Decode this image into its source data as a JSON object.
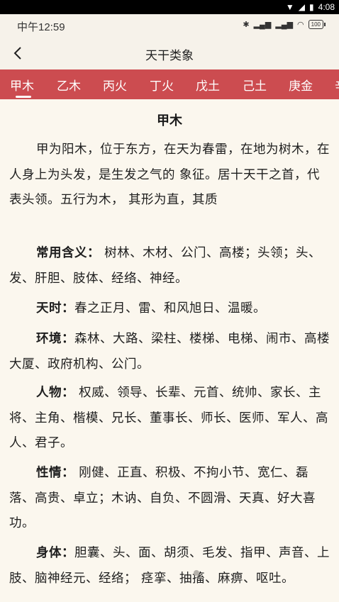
{
  "system_bar": {
    "time": "4:08"
  },
  "status_bar": {
    "time": "中午12:59",
    "battery": "100"
  },
  "nav": {
    "title": "天干类象"
  },
  "tabs": [
    "甲木",
    "乙木",
    "丙火",
    "丁火",
    "戊土",
    "己土",
    "庚金",
    "辛金"
  ],
  "selected_tab": "甲木",
  "article": {
    "heading": "甲木",
    "intro": "甲为阳木，位于东方，在天为春雷，在地为树木，在人身上为头发，是生发之气的 象征。居十天干之首，代表头领。五行为木， 其形为直，其质",
    "sections": [
      {
        "label": "常用含义：",
        "text": " 树林、木材、公门、高楼；头领；头、发、肝胆、肢体、经络、神经。"
      },
      {
        "label": "天时：",
        "text": "春之正月、雷、和风旭日、温暖。"
      },
      {
        "label": "环境：",
        "text": "森林、大路、梁柱、楼梯、电梯、闹市、高楼大厦、政府机构、公门。"
      },
      {
        "label": "人物：",
        "text": " 权威、领导、长辈、元首、统帅、家长、主将、主角、楷模、兄长、董事长、师长、医师、军人、高人、君子。"
      },
      {
        "label": "性情：",
        "text": " 刚健、正直、积极、不拘小节、宽仁、磊落、高贵、卓立；木讷、自负、不圆滑、天真、好大喜功。"
      },
      {
        "label": "身体：",
        "text": "胆囊、头、面、胡须、毛发、指甲、声音、上肢、脑神经元、经络； 痉挛、抽搐、麻痹、呕吐。"
      }
    ]
  }
}
